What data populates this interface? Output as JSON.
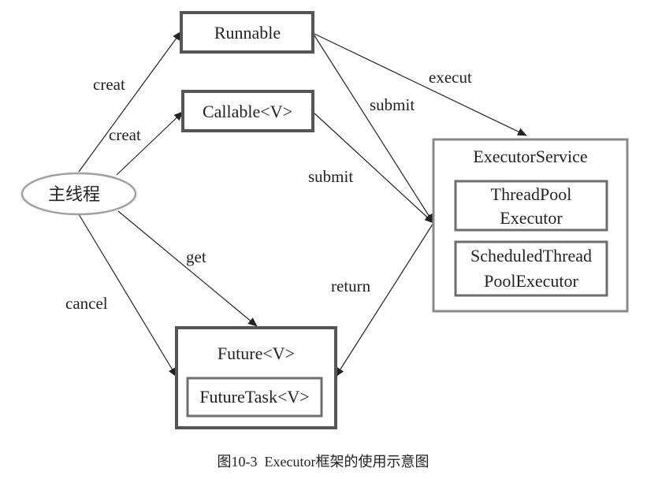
{
  "nodes": {
    "main_thread": "主线程",
    "runnable": "Runnable",
    "callable": "Callable<V>",
    "executor_service": "ExecutorService",
    "thread_pool_line1": "ThreadPool",
    "thread_pool_line2": "Executor",
    "scheduled_line1": "ScheduledThread",
    "scheduled_line2": "PoolExecutor",
    "future": "Future<V>",
    "future_task": "FutureTask<V>"
  },
  "edges": {
    "creat_runnable": "creat",
    "creat_callable": "creat",
    "get": "get",
    "cancel": "cancel",
    "execut": "execut",
    "submit_runnable": "submit",
    "submit_callable": "submit",
    "return": "return"
  },
  "caption": "图10-3  Executor框架的使用示意图"
}
